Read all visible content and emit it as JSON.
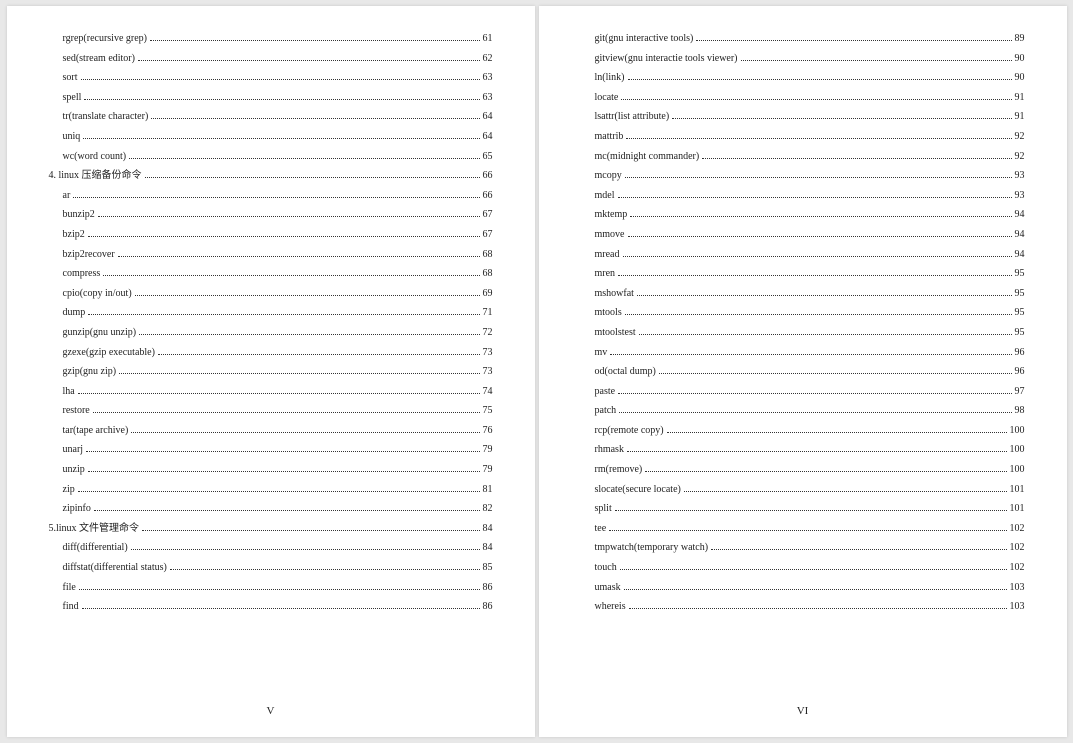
{
  "left": {
    "footer": "V",
    "entries": [
      {
        "level": 2,
        "title": "rgrep(recursive grep)",
        "page": "61"
      },
      {
        "level": 2,
        "title": "sed(stream editor)",
        "page": "62"
      },
      {
        "level": 2,
        "title": "sort",
        "page": "63"
      },
      {
        "level": 2,
        "title": "spell",
        "page": "63"
      },
      {
        "level": 2,
        "title": "tr(translate character)",
        "page": "64"
      },
      {
        "level": 2,
        "title": "uniq",
        "page": "64"
      },
      {
        "level": 2,
        "title": "wc(word count)",
        "page": "65"
      },
      {
        "level": 1,
        "title": "4. linux 压缩备份命令",
        "page": "66"
      },
      {
        "level": 2,
        "title": "ar",
        "page": "66"
      },
      {
        "level": 2,
        "title": "bunzip2",
        "page": "67"
      },
      {
        "level": 2,
        "title": "bzip2",
        "page": "67"
      },
      {
        "level": 2,
        "title": "bzip2recover",
        "page": "68"
      },
      {
        "level": 2,
        "title": "compress",
        "page": "68"
      },
      {
        "level": 2,
        "title": "cpio(copy in/out)",
        "page": "69"
      },
      {
        "level": 2,
        "title": "dump",
        "page": "71"
      },
      {
        "level": 2,
        "title": "gunzip(gnu unzip)",
        "page": "72"
      },
      {
        "level": 2,
        "title": "gzexe(gzip executable)",
        "page": "73"
      },
      {
        "level": 2,
        "title": "gzip(gnu zip)",
        "page": "73"
      },
      {
        "level": 2,
        "title": "lha",
        "page": "74"
      },
      {
        "level": 2,
        "title": "restore",
        "page": "75"
      },
      {
        "level": 2,
        "title": "tar(tape archive)",
        "page": "76"
      },
      {
        "level": 2,
        "title": "unarj",
        "page": "79"
      },
      {
        "level": 2,
        "title": "unzip",
        "page": "79"
      },
      {
        "level": 2,
        "title": "zip",
        "page": "81"
      },
      {
        "level": 2,
        "title": "zipinfo",
        "page": "82"
      },
      {
        "level": 1,
        "title": "5.linux 文件管理命令",
        "page": "84"
      },
      {
        "level": 2,
        "title": "diff(differential)",
        "page": "84"
      },
      {
        "level": 2,
        "title": "diffstat(differential status)",
        "page": "85"
      },
      {
        "level": 2,
        "title": "file",
        "page": "86"
      },
      {
        "level": 2,
        "title": "find",
        "page": "86"
      }
    ]
  },
  "right": {
    "footer": "VI",
    "entries": [
      {
        "level": 2,
        "title": "git(gnu interactive tools)",
        "page": "89"
      },
      {
        "level": 2,
        "title": "gitview(gnu interactie tools viewer)",
        "page": "90"
      },
      {
        "level": 2,
        "title": "ln(link)",
        "page": "90"
      },
      {
        "level": 2,
        "title": "locate",
        "page": "91"
      },
      {
        "level": 2,
        "title": "lsattr(list attribute)",
        "page": "91"
      },
      {
        "level": 2,
        "title": "mattrib",
        "page": "92"
      },
      {
        "level": 2,
        "title": "mc(midnight commander)",
        "page": "92"
      },
      {
        "level": 2,
        "title": "mcopy",
        "page": "93"
      },
      {
        "level": 2,
        "title": "mdel",
        "page": "93"
      },
      {
        "level": 2,
        "title": "mktemp",
        "page": "94"
      },
      {
        "level": 2,
        "title": "mmove",
        "page": "94"
      },
      {
        "level": 2,
        "title": "mread",
        "page": "94"
      },
      {
        "level": 2,
        "title": "mren",
        "page": "95"
      },
      {
        "level": 2,
        "title": "mshowfat",
        "page": "95"
      },
      {
        "level": 2,
        "title": "mtools",
        "page": "95"
      },
      {
        "level": 2,
        "title": "mtoolstest",
        "page": "95"
      },
      {
        "level": 2,
        "title": "mv",
        "page": "96"
      },
      {
        "level": 2,
        "title": "od(octal dump)",
        "page": "96"
      },
      {
        "level": 2,
        "title": "paste",
        "page": "97"
      },
      {
        "level": 2,
        "title": "patch",
        "page": "98"
      },
      {
        "level": 2,
        "title": "rcp(remote copy)",
        "page": "100"
      },
      {
        "level": 2,
        "title": "rhmask",
        "page": "100"
      },
      {
        "level": 2,
        "title": "rm(remove)",
        "page": "100"
      },
      {
        "level": 2,
        "title": "slocate(secure locate)",
        "page": "101"
      },
      {
        "level": 2,
        "title": "split",
        "page": "101"
      },
      {
        "level": 2,
        "title": "tee",
        "page": "102"
      },
      {
        "level": 2,
        "title": "tmpwatch(temporary watch)",
        "page": "102"
      },
      {
        "level": 2,
        "title": "touch",
        "page": "102"
      },
      {
        "level": 2,
        "title": "umask",
        "page": "103"
      },
      {
        "level": 2,
        "title": "whereis",
        "page": "103"
      }
    ]
  }
}
